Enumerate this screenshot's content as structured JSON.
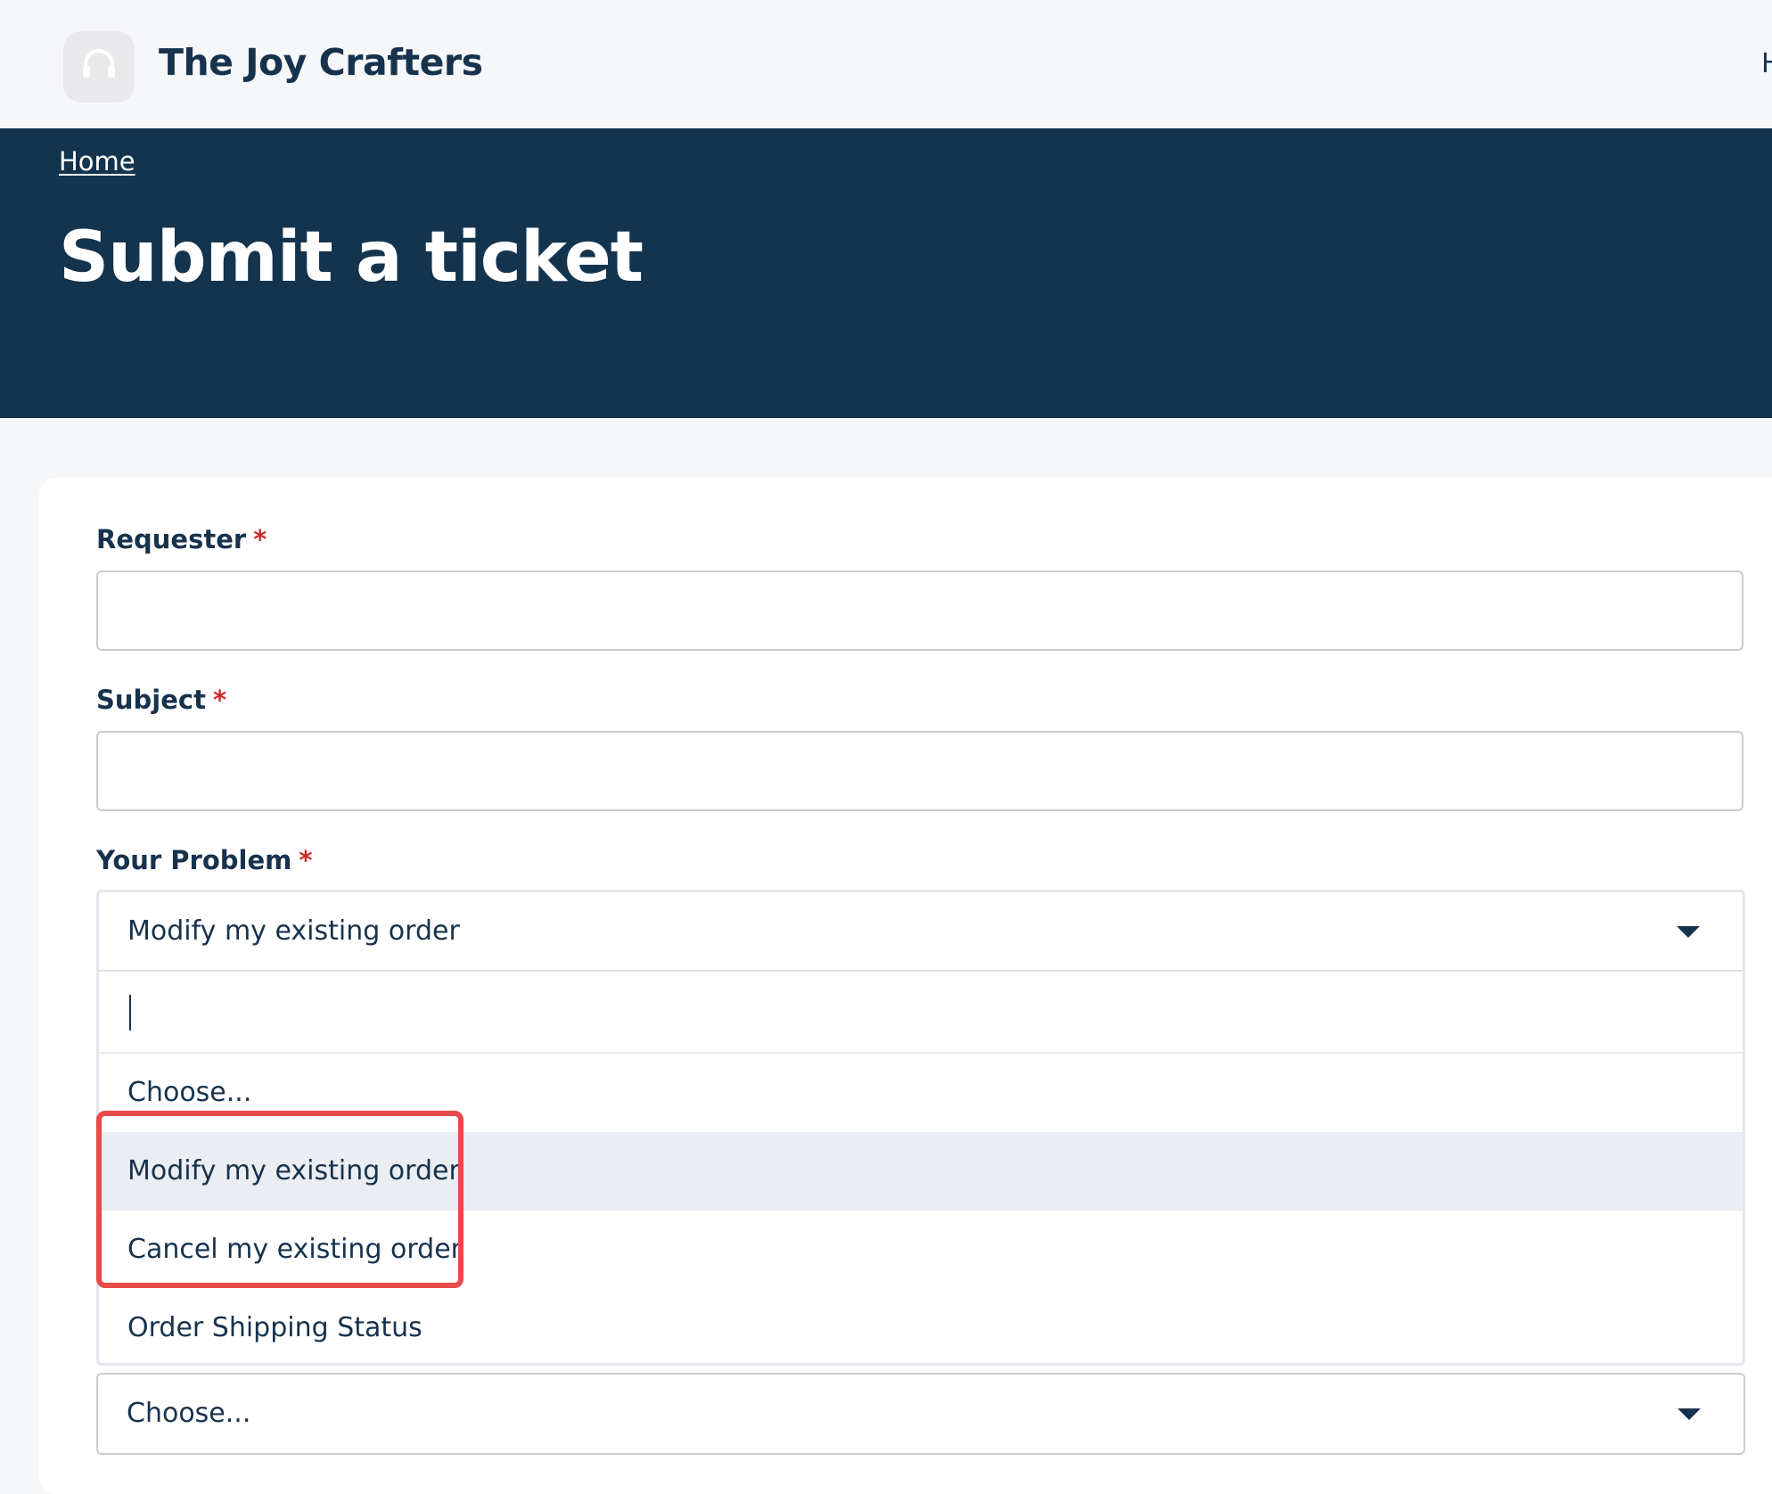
{
  "header": {
    "brand": "The Joy Crafters",
    "logo_icon": "headset-icon",
    "nav_partial": "H"
  },
  "hero": {
    "breadcrumb_home": "Home",
    "title": "Submit a ticket"
  },
  "form": {
    "requester": {
      "label": "Requester",
      "required_mark": "*",
      "value": ""
    },
    "subject": {
      "label": "Subject",
      "required_mark": "*",
      "value": ""
    },
    "problem": {
      "label": "Your Problem",
      "required_mark": "*",
      "selected": "Modify my existing order",
      "search_value": "",
      "options": [
        "Choose...",
        "Modify my existing order",
        "Cancel my existing order",
        "Order Shipping Status"
      ],
      "highlighted_option": "Modify my existing order"
    },
    "next_select": {
      "selected": "Choose..."
    }
  },
  "colors": {
    "hero_bg": "#14344e",
    "text": "#17324d",
    "required": "#cc2b2b",
    "highlight_bg": "#eaedf1",
    "annotation": "#e84a4a"
  }
}
